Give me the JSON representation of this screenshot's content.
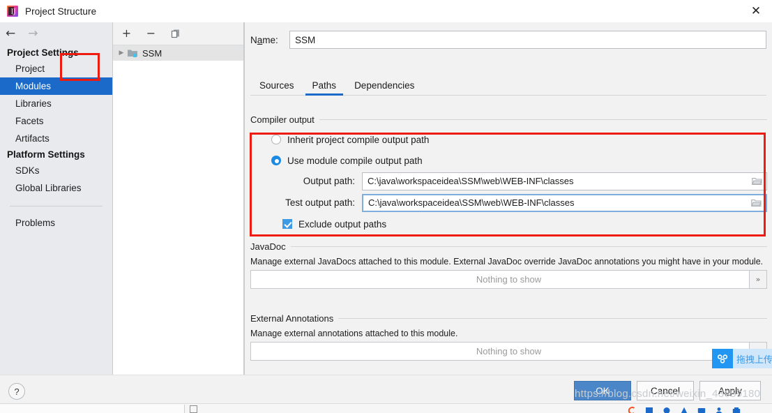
{
  "window": {
    "title": "Project Structure",
    "app_icon": "intellij-idea-icon",
    "close_label": "✕"
  },
  "sidebar": {
    "back_arrow": "←",
    "forward_arrow": "→",
    "groups": [
      {
        "title": "Project Settings",
        "items": [
          {
            "label": "Project",
            "selected": false
          },
          {
            "label": "Modules",
            "selected": true
          },
          {
            "label": "Libraries",
            "selected": false
          },
          {
            "label": "Facets",
            "selected": false
          },
          {
            "label": "Artifacts",
            "selected": false
          }
        ]
      },
      {
        "title": "Platform Settings",
        "items": [
          {
            "label": "SDKs",
            "selected": false
          },
          {
            "label": "Global Libraries",
            "selected": false
          }
        ]
      }
    ],
    "extra_items": [
      {
        "label": "Problems",
        "selected": false
      }
    ]
  },
  "tree_panel": {
    "toolbar": {
      "add_label": "+",
      "remove_label": "−",
      "copy_label": "❐"
    },
    "nodes": [
      {
        "label": "SSM",
        "twisty": "▶",
        "icon": "module-folder-icon",
        "selected": true
      }
    ]
  },
  "module": {
    "name_label_pre": "N",
    "name_label_mnemonic": "a",
    "name_label_post": "me:",
    "name_value": "SSM",
    "tabs": [
      {
        "label": "Sources",
        "active": false
      },
      {
        "label": "Paths",
        "active": true
      },
      {
        "label": "Dependencies",
        "active": false
      }
    ],
    "compiler_output": {
      "group_title": "Compiler output",
      "inherit_option": {
        "label": "Inherit project compile output path",
        "checked": false
      },
      "module_option": {
        "label": "Use module compile output path",
        "checked": true
      },
      "output_path": {
        "label": "Output path:",
        "value": "C:\\java\\workspaceidea\\SSM\\web\\WEB-INF\\classes",
        "focused": false,
        "browse_icon": "folder-icon"
      },
      "test_output_path": {
        "label": "Test output path:",
        "value": "C:\\java\\workspaceidea\\SSM\\web\\WEB-INF\\classes",
        "focused": true,
        "browse_icon": "folder-icon"
      },
      "exclude_checkbox": {
        "label": "Exclude output paths",
        "checked": true
      }
    },
    "javadoc": {
      "group_title": "JavaDoc",
      "description": "Manage external JavaDocs attached to this module. External JavaDoc override JavaDoc annotations you might have in your module.",
      "empty_text": "Nothing to show",
      "expand_label": "»"
    },
    "external_annotations": {
      "group_title": "External Annotations",
      "description": "Manage external annotations attached to this module.",
      "empty_text": "Nothing to show",
      "expand_label": "»"
    }
  },
  "footer": {
    "help_label": "?",
    "ok": {
      "label": "OK",
      "primary": true
    },
    "cancel": {
      "label": "Cancel",
      "primary": false
    },
    "apply_pre": "A",
    "apply_mnemonic": "p",
    "apply_post": "ply"
  },
  "overlays": {
    "watermark": "https://blog.csdn.net/weixin_43659180",
    "netdisk_text": "拖拽上传",
    "netdisk_icon": "baidu-netdisk-icon"
  },
  "colors": {
    "accent": "#1b6ac9",
    "selection": "#1b6ac9",
    "annotation_red": "#ee1b11",
    "radio_blue": "#1b8ae5",
    "checkbox_blue": "#3f9ae5",
    "primary_button": "#4a86c8"
  }
}
